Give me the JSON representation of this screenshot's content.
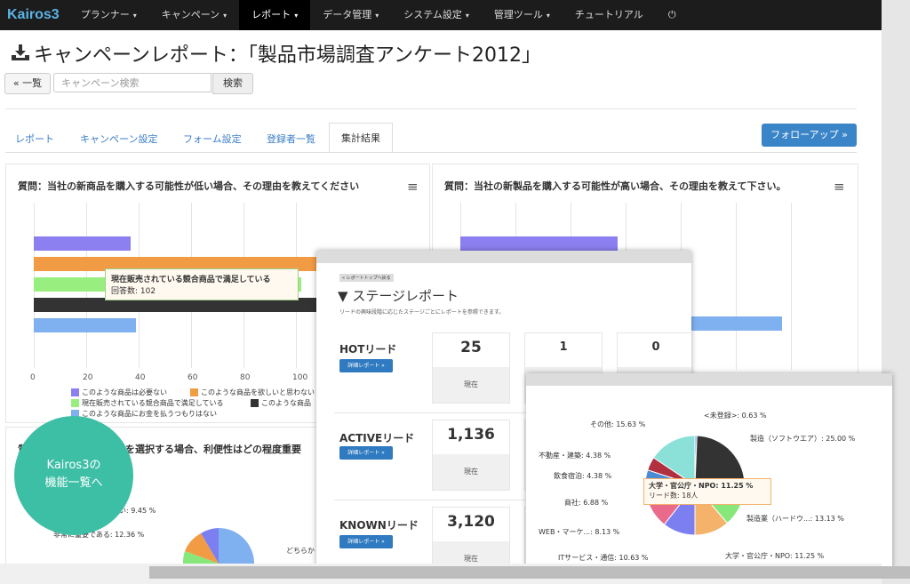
{
  "app": {
    "brand": "Kairos3"
  },
  "nav": {
    "items": [
      {
        "label": "プランナー",
        "caret": "▾"
      },
      {
        "label": "キャンペーン",
        "caret": "▾"
      },
      {
        "label": "レポート",
        "caret": "▾",
        "active": true
      },
      {
        "label": "データ管理",
        "caret": "▾"
      },
      {
        "label": "システム設定",
        "caret": "▾"
      },
      {
        "label": "管理ツール",
        "caret": "▾"
      },
      {
        "label": "チュートリアル",
        "caret": ""
      }
    ],
    "power_icon": "⏻"
  },
  "page": {
    "title": "キャンペーンレポート：「製品市場調査アンケート2012」",
    "title_icon": "download-icon",
    "back_label": "« 一覧",
    "search_placeholder": "キャンペーン検索",
    "search_button": "検索",
    "followup_label": "フォローアップ »"
  },
  "tabs": [
    {
      "label": "レポート"
    },
    {
      "label": "キャンペーン設定"
    },
    {
      "label": "フォーム設定"
    },
    {
      "label": "登録者一覧"
    },
    {
      "label": "集計結果",
      "active": true
    }
  ],
  "questions": {
    "q1": "質問：当社の新商品を購入する可能性が低い場合、その理由を教えてください",
    "q2": "質問：当社の新製品を購入する可能性が高い場合、その理由を教えて下さい。",
    "q3": "質問：このタイプの商品を選択する場合、利便性はどの程度重要",
    "menu_icon": "≡"
  },
  "chart_data": [
    {
      "type": "bar",
      "orientation": "horizontal",
      "title": "質問：当社の新商品を購入する可能性が低い場合、その理由を教えてください",
      "xlim": [
        0,
        100
      ],
      "xticks": [
        "0",
        "20",
        "40",
        "60",
        "80",
        "100"
      ],
      "series": [
        {
          "name": "このような商品は必要ない",
          "value": 37,
          "color": "#8c7ff0"
        },
        {
          "name": "このような商品を欲しいと思わない",
          "value": 110,
          "color": "#f29b45"
        },
        {
          "name": "現在販売されている競合商品で満足している",
          "value": 102,
          "color": "#98ef80"
        },
        {
          "name": "このような商品",
          "value": 110,
          "color": "#333333"
        },
        {
          "name": "このような商品にお金を払うつもりはない",
          "value": 39,
          "color": "#7fb0ef"
        }
      ],
      "tooltip": {
        "title": "現在販売されている競合商品で満足している",
        "value": "回答数: 102"
      }
    },
    {
      "type": "pie",
      "title": "",
      "slices": [
        {
          "label": "<未登録>: 0.63 %",
          "value": 0.63,
          "color": "#5ea0e6"
        },
        {
          "label": "製造（ソフトウエア）: 25.00 %",
          "value": 25.0,
          "color": "#333333"
        },
        {
          "label": "製造業（ハードウ...: 13.13 %",
          "value": 13.13,
          "color": "#88e77a"
        },
        {
          "label": "大学・官公庁・NPO: 11.25 %",
          "value": 11.25,
          "color": "#f4b26b"
        },
        {
          "label": "ITサービス・通信: 10.63 %",
          "value": 10.63,
          "color": "#7b7ff0"
        },
        {
          "label": "WEB・マーケ...: 8.13 %",
          "value": 8.13,
          "color": "#e96a8a"
        },
        {
          "label": "商社: 6.88 %",
          "value": 6.88,
          "color": "#e3d44a"
        },
        {
          "label": "飲食宿泊: 4.38 %",
          "value": 4.38,
          "color": "#4a8bd4"
        },
        {
          "label": "不動産・建築: 4.38 %",
          "value": 4.38,
          "color": "#b03040"
        },
        {
          "label": "その他: 15.63 %",
          "value": 15.63,
          "color": "#8be0d8"
        }
      ],
      "tooltip": {
        "title": "大学・官公庁・NPO: 11.25 %",
        "value": "リード数: 18人"
      }
    }
  ],
  "small_pie": {
    "labels": [
      "あまり重要ではない: 9.45 %",
      "非常に重要である: 12.36 %",
      "どちらか"
    ]
  },
  "stage_report": {
    "breadcrumb": "« レポートトップへ戻る",
    "title": "ステージレポート",
    "subtitle": "リードの興味段階に応じたステージごとにレポートを参照できます。",
    "detail_label": "詳細レポート »",
    "current_label": "現在",
    "rows": [
      {
        "label": "HOTリード",
        "value": "25",
        "col2": "1",
        "col3": "0"
      },
      {
        "label": "ACTIVEリード",
        "value": "1,136"
      },
      {
        "label": "KNOWNリード",
        "value": "3,120"
      }
    ]
  },
  "promo": {
    "line1": "Kairos3の",
    "line2": "機能一覧へ"
  }
}
